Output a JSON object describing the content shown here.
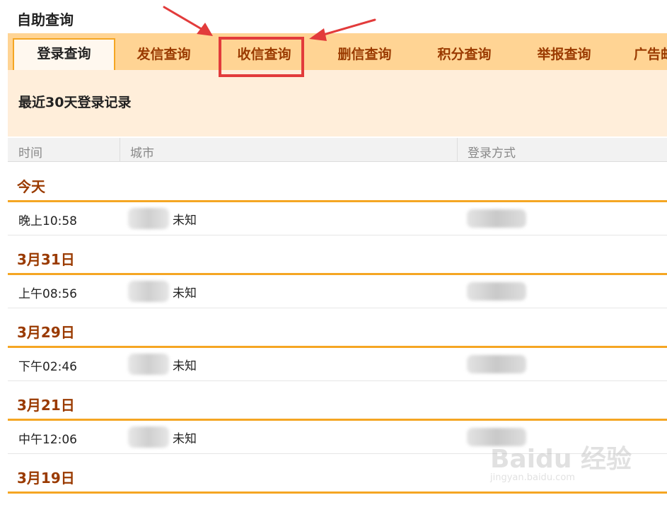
{
  "page_title": "自助查询",
  "tabs": [
    {
      "label": "登录查询",
      "active": true
    },
    {
      "label": "发信查询",
      "active": false
    },
    {
      "label": "收信查询",
      "active": false
    },
    {
      "label": "删信查询",
      "active": false
    },
    {
      "label": "积分查询",
      "active": false
    },
    {
      "label": "举报查询",
      "active": false
    },
    {
      "label": "广告邮",
      "active": false
    }
  ],
  "panel_title": "最近30天登录记录",
  "columns": {
    "time": "时间",
    "city": "城市",
    "method": "登录方式"
  },
  "groups": [
    {
      "date": "今天",
      "rows": [
        {
          "time": "晚上10:58",
          "city": "未知"
        }
      ]
    },
    {
      "date": "3月31日",
      "rows": [
        {
          "time": "上午08:56",
          "city": "未知"
        }
      ]
    },
    {
      "date": "3月29日",
      "rows": [
        {
          "time": "下午02:46",
          "city": "未知"
        }
      ]
    },
    {
      "date": "3月21日",
      "rows": [
        {
          "time": "中午12:06",
          "city": "未知"
        }
      ]
    },
    {
      "date": "3月19日",
      "rows": []
    }
  ],
  "watermark": {
    "brand": "Baidu 经验",
    "url": "jingyan.baidu.com"
  },
  "colors": {
    "accent": "#f5a623",
    "tab_bg": "#ffd494",
    "date_text": "#9a3a00",
    "highlight": "#e23b3b"
  }
}
